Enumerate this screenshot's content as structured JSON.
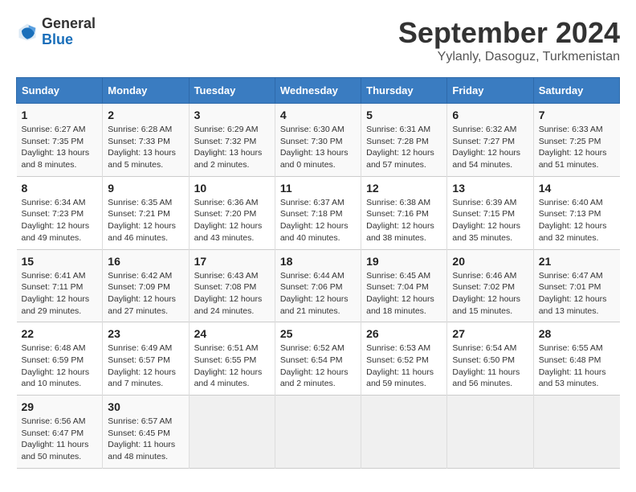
{
  "header": {
    "logo_line1": "General",
    "logo_line2": "Blue",
    "month": "September 2024",
    "location": "Yylanly, Dasoguz, Turkmenistan"
  },
  "weekdays": [
    "Sunday",
    "Monday",
    "Tuesday",
    "Wednesday",
    "Thursday",
    "Friday",
    "Saturday"
  ],
  "weeks": [
    [
      {
        "day": "1",
        "sunrise": "Sunrise: 6:27 AM",
        "sunset": "Sunset: 7:35 PM",
        "daylight": "Daylight: 13 hours and 8 minutes."
      },
      {
        "day": "2",
        "sunrise": "Sunrise: 6:28 AM",
        "sunset": "Sunset: 7:33 PM",
        "daylight": "Daylight: 13 hours and 5 minutes."
      },
      {
        "day": "3",
        "sunrise": "Sunrise: 6:29 AM",
        "sunset": "Sunset: 7:32 PM",
        "daylight": "Daylight: 13 hours and 2 minutes."
      },
      {
        "day": "4",
        "sunrise": "Sunrise: 6:30 AM",
        "sunset": "Sunset: 7:30 PM",
        "daylight": "Daylight: 13 hours and 0 minutes."
      },
      {
        "day": "5",
        "sunrise": "Sunrise: 6:31 AM",
        "sunset": "Sunset: 7:28 PM",
        "daylight": "Daylight: 12 hours and 57 minutes."
      },
      {
        "day": "6",
        "sunrise": "Sunrise: 6:32 AM",
        "sunset": "Sunset: 7:27 PM",
        "daylight": "Daylight: 12 hours and 54 minutes."
      },
      {
        "day": "7",
        "sunrise": "Sunrise: 6:33 AM",
        "sunset": "Sunset: 7:25 PM",
        "daylight": "Daylight: 12 hours and 51 minutes."
      }
    ],
    [
      {
        "day": "8",
        "sunrise": "Sunrise: 6:34 AM",
        "sunset": "Sunset: 7:23 PM",
        "daylight": "Daylight: 12 hours and 49 minutes."
      },
      {
        "day": "9",
        "sunrise": "Sunrise: 6:35 AM",
        "sunset": "Sunset: 7:21 PM",
        "daylight": "Daylight: 12 hours and 46 minutes."
      },
      {
        "day": "10",
        "sunrise": "Sunrise: 6:36 AM",
        "sunset": "Sunset: 7:20 PM",
        "daylight": "Daylight: 12 hours and 43 minutes."
      },
      {
        "day": "11",
        "sunrise": "Sunrise: 6:37 AM",
        "sunset": "Sunset: 7:18 PM",
        "daylight": "Daylight: 12 hours and 40 minutes."
      },
      {
        "day": "12",
        "sunrise": "Sunrise: 6:38 AM",
        "sunset": "Sunset: 7:16 PM",
        "daylight": "Daylight: 12 hours and 38 minutes."
      },
      {
        "day": "13",
        "sunrise": "Sunrise: 6:39 AM",
        "sunset": "Sunset: 7:15 PM",
        "daylight": "Daylight: 12 hours and 35 minutes."
      },
      {
        "day": "14",
        "sunrise": "Sunrise: 6:40 AM",
        "sunset": "Sunset: 7:13 PM",
        "daylight": "Daylight: 12 hours and 32 minutes."
      }
    ],
    [
      {
        "day": "15",
        "sunrise": "Sunrise: 6:41 AM",
        "sunset": "Sunset: 7:11 PM",
        "daylight": "Daylight: 12 hours and 29 minutes."
      },
      {
        "day": "16",
        "sunrise": "Sunrise: 6:42 AM",
        "sunset": "Sunset: 7:09 PM",
        "daylight": "Daylight: 12 hours and 27 minutes."
      },
      {
        "day": "17",
        "sunrise": "Sunrise: 6:43 AM",
        "sunset": "Sunset: 7:08 PM",
        "daylight": "Daylight: 12 hours and 24 minutes."
      },
      {
        "day": "18",
        "sunrise": "Sunrise: 6:44 AM",
        "sunset": "Sunset: 7:06 PM",
        "daylight": "Daylight: 12 hours and 21 minutes."
      },
      {
        "day": "19",
        "sunrise": "Sunrise: 6:45 AM",
        "sunset": "Sunset: 7:04 PM",
        "daylight": "Daylight: 12 hours and 18 minutes."
      },
      {
        "day": "20",
        "sunrise": "Sunrise: 6:46 AM",
        "sunset": "Sunset: 7:02 PM",
        "daylight": "Daylight: 12 hours and 15 minutes."
      },
      {
        "day": "21",
        "sunrise": "Sunrise: 6:47 AM",
        "sunset": "Sunset: 7:01 PM",
        "daylight": "Daylight: 12 hours and 13 minutes."
      }
    ],
    [
      {
        "day": "22",
        "sunrise": "Sunrise: 6:48 AM",
        "sunset": "Sunset: 6:59 PM",
        "daylight": "Daylight: 12 hours and 10 minutes."
      },
      {
        "day": "23",
        "sunrise": "Sunrise: 6:49 AM",
        "sunset": "Sunset: 6:57 PM",
        "daylight": "Daylight: 12 hours and 7 minutes."
      },
      {
        "day": "24",
        "sunrise": "Sunrise: 6:51 AM",
        "sunset": "Sunset: 6:55 PM",
        "daylight": "Daylight: 12 hours and 4 minutes."
      },
      {
        "day": "25",
        "sunrise": "Sunrise: 6:52 AM",
        "sunset": "Sunset: 6:54 PM",
        "daylight": "Daylight: 12 hours and 2 minutes."
      },
      {
        "day": "26",
        "sunrise": "Sunrise: 6:53 AM",
        "sunset": "Sunset: 6:52 PM",
        "daylight": "Daylight: 11 hours and 59 minutes."
      },
      {
        "day": "27",
        "sunrise": "Sunrise: 6:54 AM",
        "sunset": "Sunset: 6:50 PM",
        "daylight": "Daylight: 11 hours and 56 minutes."
      },
      {
        "day": "28",
        "sunrise": "Sunrise: 6:55 AM",
        "sunset": "Sunset: 6:48 PM",
        "daylight": "Daylight: 11 hours and 53 minutes."
      }
    ],
    [
      {
        "day": "29",
        "sunrise": "Sunrise: 6:56 AM",
        "sunset": "Sunset: 6:47 PM",
        "daylight": "Daylight: 11 hours and 50 minutes."
      },
      {
        "day": "30",
        "sunrise": "Sunrise: 6:57 AM",
        "sunset": "Sunset: 6:45 PM",
        "daylight": "Daylight: 11 hours and 48 minutes."
      },
      null,
      null,
      null,
      null,
      null
    ]
  ]
}
